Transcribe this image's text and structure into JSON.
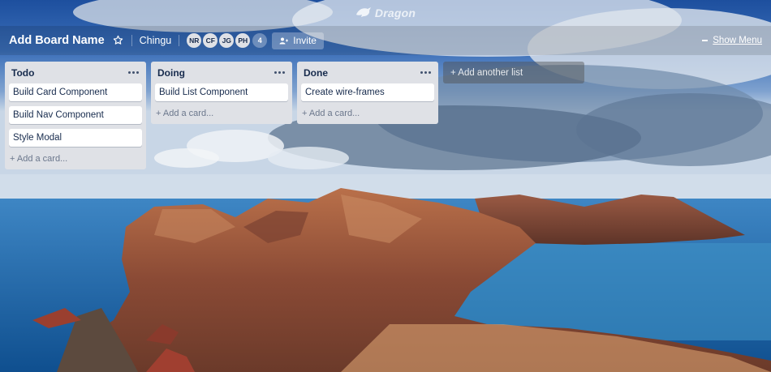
{
  "app": {
    "logo_text": "Dragon"
  },
  "board": {
    "title": "Add Board Name",
    "team": "Chingu",
    "members": [
      "NR",
      "CF",
      "JG",
      "PH"
    ],
    "member_count": "4",
    "invite_label": "Invite",
    "menu_label": "Show Menu"
  },
  "lists": [
    {
      "title": "Todo",
      "cards": [
        "Build Card Component",
        "Build Nav Component",
        "Style Modal"
      ],
      "add_label": "+ Add a card..."
    },
    {
      "title": "Doing",
      "cards": [
        "Build List Component"
      ],
      "add_label": "+ Add a card..."
    },
    {
      "title": "Done",
      "cards": [
        "Create wire-frames"
      ],
      "add_label": "+ Add a card..."
    }
  ],
  "add_list_label": "+ Add another list",
  "icons": {
    "logo": "dragon-logo-icon",
    "star": "star-icon",
    "invite": "add-person-icon",
    "menu": "dash-icon",
    "list_menu": "more-dots-icon"
  }
}
